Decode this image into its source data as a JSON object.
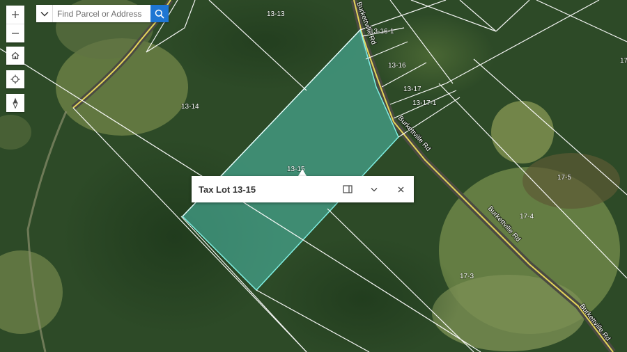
{
  "search": {
    "placeholder": "Find Parcel or Address"
  },
  "popup": {
    "title": "Tax Lot 13-15"
  },
  "roads": [
    {
      "name": "Burkettville Rd"
    }
  ],
  "parcels": [
    "13-13",
    "13-16-1",
    "13-16",
    "13-17",
    "13-17-1",
    "13-14",
    "13-15",
    "17-5",
    "17-4",
    "17-3",
    "17"
  ],
  "colors": {
    "selection_fill": "#4fc3b0",
    "selection_outline": "#7ff0e4",
    "search_button": "#1e76d3",
    "parcel_lines": "#ffffff"
  },
  "icons": {
    "zoom_in": "plus-icon",
    "zoom_out": "minus-icon",
    "home": "home-icon",
    "locate": "locate-icon",
    "compass": "compass-icon",
    "search_dropdown": "chevron-down-icon",
    "search_button": "search-icon",
    "dock": "dock-icon",
    "collapse": "chevron-down-icon",
    "close": "close-icon"
  }
}
